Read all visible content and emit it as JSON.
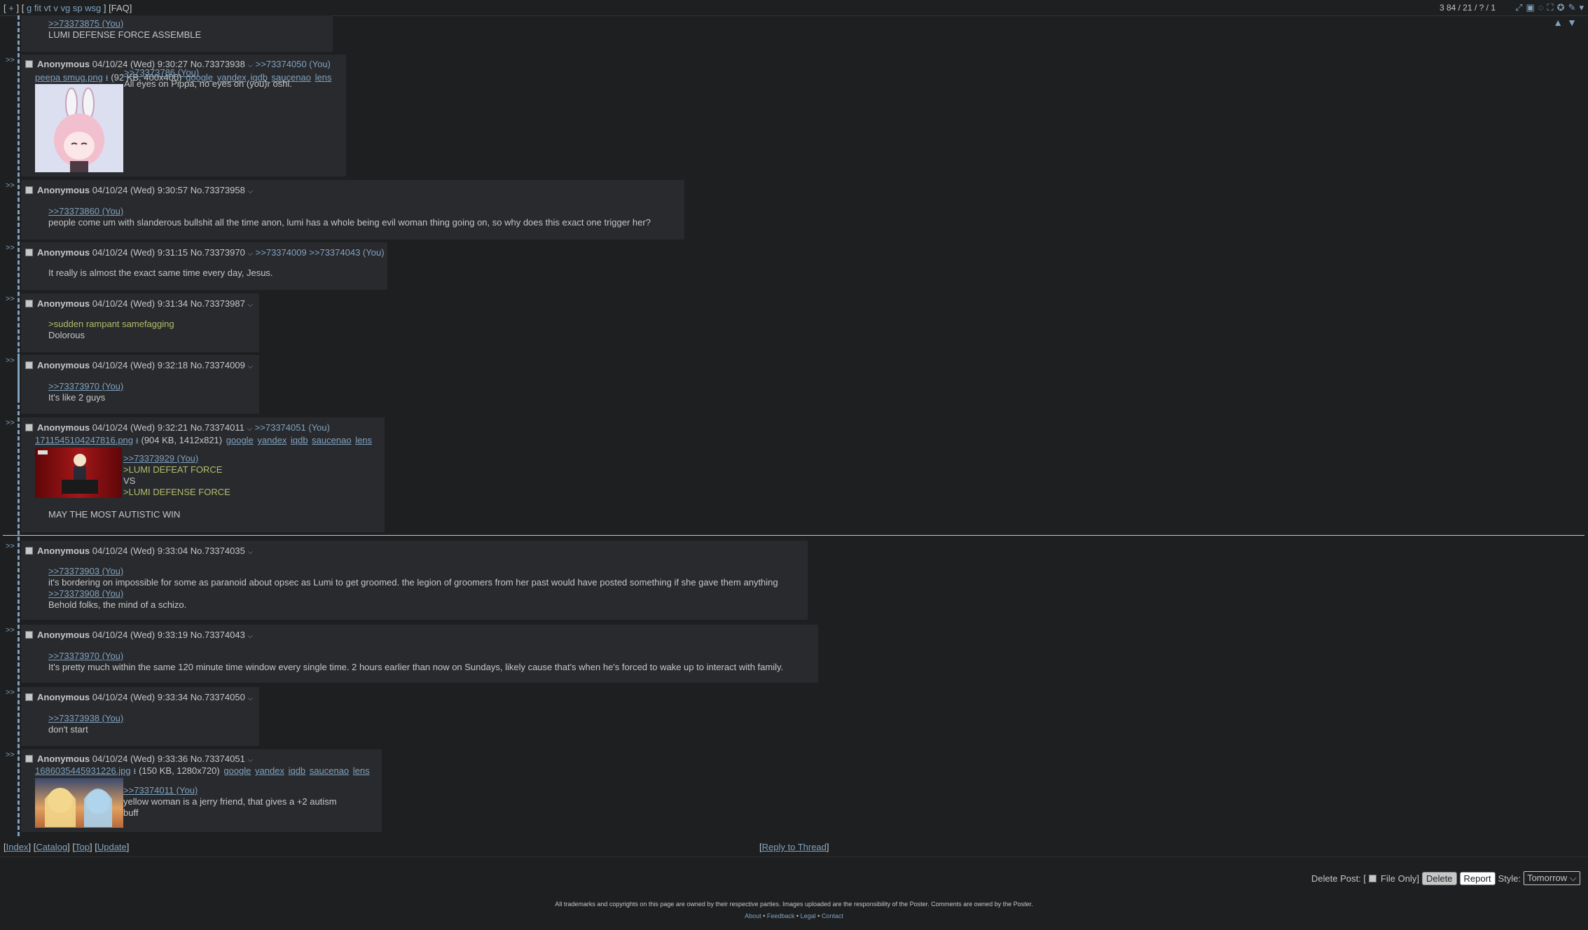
{
  "topbar": {
    "nav": {
      "open": "[",
      "plus": "+",
      "close": "]",
      "open2": "[",
      "boards": [
        "g",
        "fit",
        "vt",
        "v",
        "vg",
        "sp",
        "wsg"
      ],
      "close2": "]",
      "faq": "[FAQ]"
    },
    "stats": "3 84 / 21 / ? / 1",
    "icons": [
      "expand-icon",
      "image-icon",
      "speech-bubble-icon",
      "fullscreen-icon",
      "settings-icon",
      "wrench-icon",
      "chevron-down-icon"
    ],
    "arrows": [
      "▲",
      "▼"
    ]
  },
  "top_partial": {
    "quote": ">>73373875 (You)",
    "text": "LUMI DEFENSE FORCE ASSEMBLE"
  },
  "posts": [
    {
      "name": "Anonymous",
      "date": "04/10/24 (Wed) 9:30:27",
      "no": "No.73373938",
      "backlinks": ">>73374050 (You)",
      "file": {
        "filename": "peepa smug.png",
        "meta": "(92 KB, 400x400)",
        "services": [
          "google",
          "yandex",
          "iqdb",
          "saucenao",
          "lens"
        ]
      },
      "quote": ">>73373786 (You)",
      "lines": [
        "All eyes on Pippa, no eyes on (you)r oshi."
      ]
    },
    {
      "name": "Anonymous",
      "date": "04/10/24 (Wed) 9:30:57",
      "no": "No.73373958",
      "backlinks": "",
      "quote": ">>73373860 (You)",
      "lines": [
        "people come um with slanderous bullshit all the time anon, lumi has a whole being evil woman thing going on, so why does this exact one trigger her?"
      ]
    },
    {
      "name": "Anonymous",
      "date": "04/10/24 (Wed) 9:31:15",
      "no": "No.73373970",
      "backlinks": ">>73374009 >>73374043 (You)",
      "lines": [
        "It really is almost the exact same time every day, Jesus."
      ]
    },
    {
      "name": "Anonymous",
      "date": "04/10/24 (Wed) 9:31:34",
      "no": "No.73373987",
      "backlinks": "",
      "lines": [
        ">sudden rampant samefagging",
        "Dolorous"
      ]
    },
    {
      "name": "Anonymous",
      "date": "04/10/24 (Wed) 9:32:18",
      "no": "No.73374009",
      "backlinks": "",
      "quote": ">>73373970 (You)",
      "lines": [
        "It's like 2 guys"
      ]
    },
    {
      "name": "Anonymous",
      "date": "04/10/24 (Wed) 9:32:21",
      "no": "No.73374011",
      "backlinks": ">>73374051 (You)",
      "file": {
        "filename": "1711545104247816.png",
        "meta": "(904 KB, 1412x821)",
        "services": [
          "google",
          "yandex",
          "iqdb",
          "saucenao",
          "lens"
        ]
      },
      "quote": ">>73373929 (You)",
      "lines": [
        ">LUMI DEFEAT FORCE",
        "VS",
        ">LUMI DEFENSE FORCE"
      ],
      "after": "MAY THE MOST AUTISTIC WIN"
    },
    {
      "name": "Anonymous",
      "date": "04/10/24 (Wed) 9:33:04",
      "no": "No.73374035",
      "backlinks": "",
      "quote": ">>73373903 (You)",
      "lines": [
        "it's bordering on impossible for some as paranoid about opsec as Lumi to get groomed. the legion of groomers from her past would have posted something if she gave them anything"
      ],
      "quote2": ">>73373908 (You)",
      "lines2": [
        "Behold folks, the mind of a schizo."
      ]
    },
    {
      "name": "Anonymous",
      "date": "04/10/24 (Wed) 9:33:19",
      "no": "No.73374043",
      "backlinks": "",
      "quote": ">>73373970 (You)",
      "lines": [
        "It's pretty much within the same 120 minute time window every single time. 2 hours earlier than now on Sundays, likely cause that's when he's forced to wake up to interact with family."
      ]
    },
    {
      "name": "Anonymous",
      "date": "04/10/24 (Wed) 9:33:34",
      "no": "No.73374050",
      "backlinks": "",
      "quote": ">>73373938 (You)",
      "lines": [
        "don't start"
      ]
    },
    {
      "name": "Anonymous",
      "date": "04/10/24 (Wed) 9:33:36",
      "no": "No.73374051",
      "backlinks": "",
      "file": {
        "filename": "1686035445931226.jpg",
        "meta": "(150 KB, 1280x720)",
        "services": [
          "google",
          "yandex",
          "iqdb",
          "saucenao",
          "lens"
        ]
      },
      "quote": ">>73374011 (You)",
      "lines": [
        "yellow woman is a jerry friend, that gives a +2 autism",
        "buff"
      ]
    }
  ],
  "sidearrow": ">>",
  "bottom": {
    "nav": [
      "[",
      "Index",
      "]",
      "[",
      "Catalog",
      "]",
      "[",
      "Top",
      "]",
      "[",
      "Update",
      "]"
    ],
    "reply_thread": "Reply to Thread",
    "delete_post_label": "Delete Post: [",
    "file_only": "File Only]",
    "delete": "Delete",
    "report": "Report",
    "style_label": "Style:",
    "style_value": "Tomorrow"
  },
  "footer": {
    "notice": "All trademarks and copyrights on this page are owned by their respective parties. Images uploaded are the responsibility of the Poster. Comments are owned by the Poster.",
    "links": [
      "About",
      "Feedback",
      "Legal",
      "Contact"
    ],
    "sep": "•"
  },
  "colors": {
    "bg": "#1d1f21",
    "post": "#282a2e",
    "link": "#81a2be",
    "greentext": "#b5bd68",
    "text": "#c5c8c6"
  }
}
